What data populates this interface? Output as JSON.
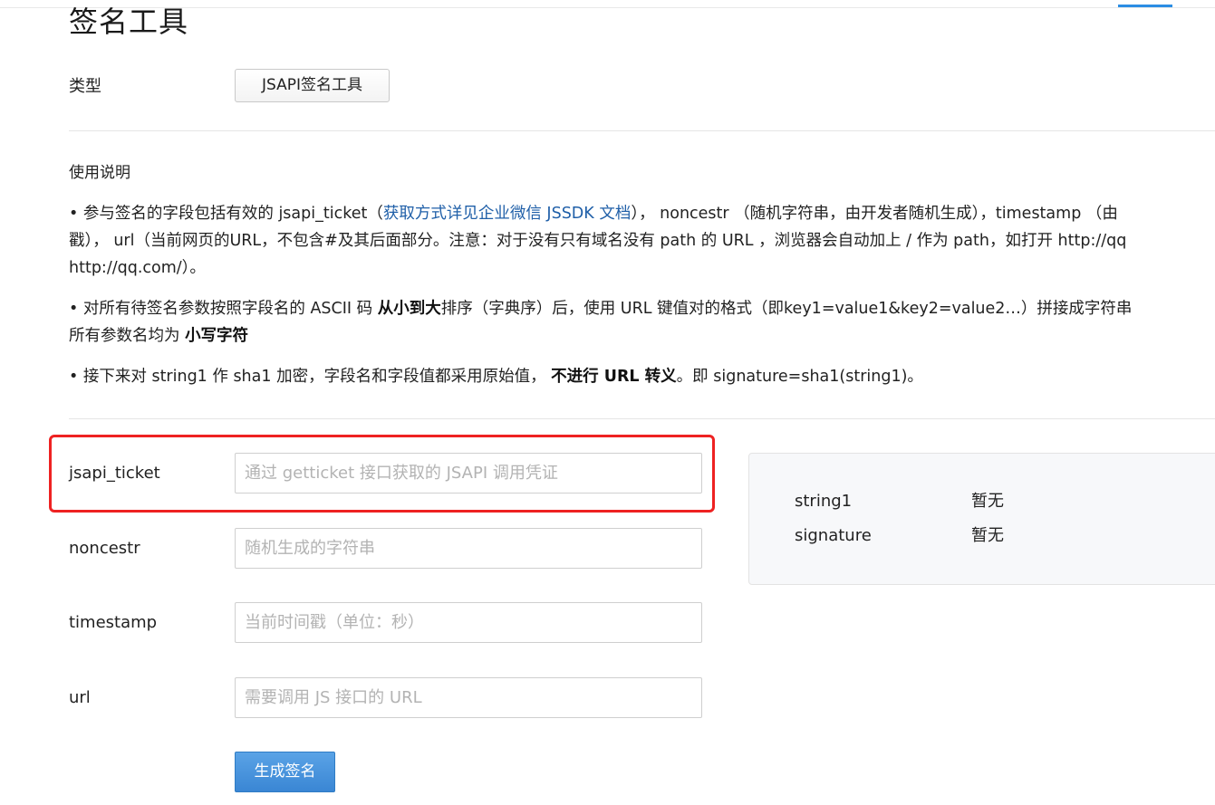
{
  "page": {
    "title": "签名工具"
  },
  "type_row": {
    "label": "类型",
    "button_label": "JSAPI签名工具"
  },
  "usage": {
    "title": "使用说明",
    "p1": {
      "part1": "• 参与签名的字段包括有效的 jsapi_ticket（",
      "link": "获取方式详见企业微信 JSSDK 文档",
      "part2": "）， noncestr （随机字符串，由开发者随机生成），timestamp （由",
      "line2": "戳）， url（当前网页的URL，不包含#及其后面部分。注意：对于没有只有域名没有 path 的 URL ，浏览器会自动加上 / 作为 path，如打开 http://qq",
      "line3": "http://qq.com/）。"
    },
    "p2": {
      "part1": "• 对所有待签名参数按照字段名的 ASCII 码 ",
      "bold1": "从小到大",
      "part2": "排序（字典序）后，使用 URL 键值对的格式（即key1=value1&key2=value2…）拼接成字符串",
      "line2_part1": "所有参数名均为 ",
      "bold2": "小写字符"
    },
    "p3": {
      "part1": "• 接下来对 string1 作 sha1 加密，字段名和字段值都采用原始值， ",
      "bold": "不进行 URL 转义",
      "part2": "。即 signature=sha1(string1)。"
    }
  },
  "form": {
    "jsapi_ticket": {
      "label": "jsapi_ticket",
      "value": "",
      "placeholder": "通过 getticket 接口获取的 JSAPI 调用凭证"
    },
    "noncestr": {
      "label": "noncestr",
      "value": "",
      "placeholder": "随机生成的字符串"
    },
    "timestamp": {
      "label": "timestamp",
      "value": "",
      "placeholder": "当前时间戳（单位：秒）"
    },
    "url": {
      "label": "url",
      "value": "",
      "placeholder": "需要调用 JS 接口的 URL"
    },
    "submit_label": "生成签名"
  },
  "result": {
    "string1": {
      "key": "string1",
      "value": "暂无"
    },
    "signature": {
      "key": "signature",
      "value": "暂无"
    }
  },
  "colors": {
    "highlight": "#ee2222",
    "link": "#1f5fa8",
    "primary_button": "#3a86d4",
    "tab_indicator": "#2b8de4"
  }
}
